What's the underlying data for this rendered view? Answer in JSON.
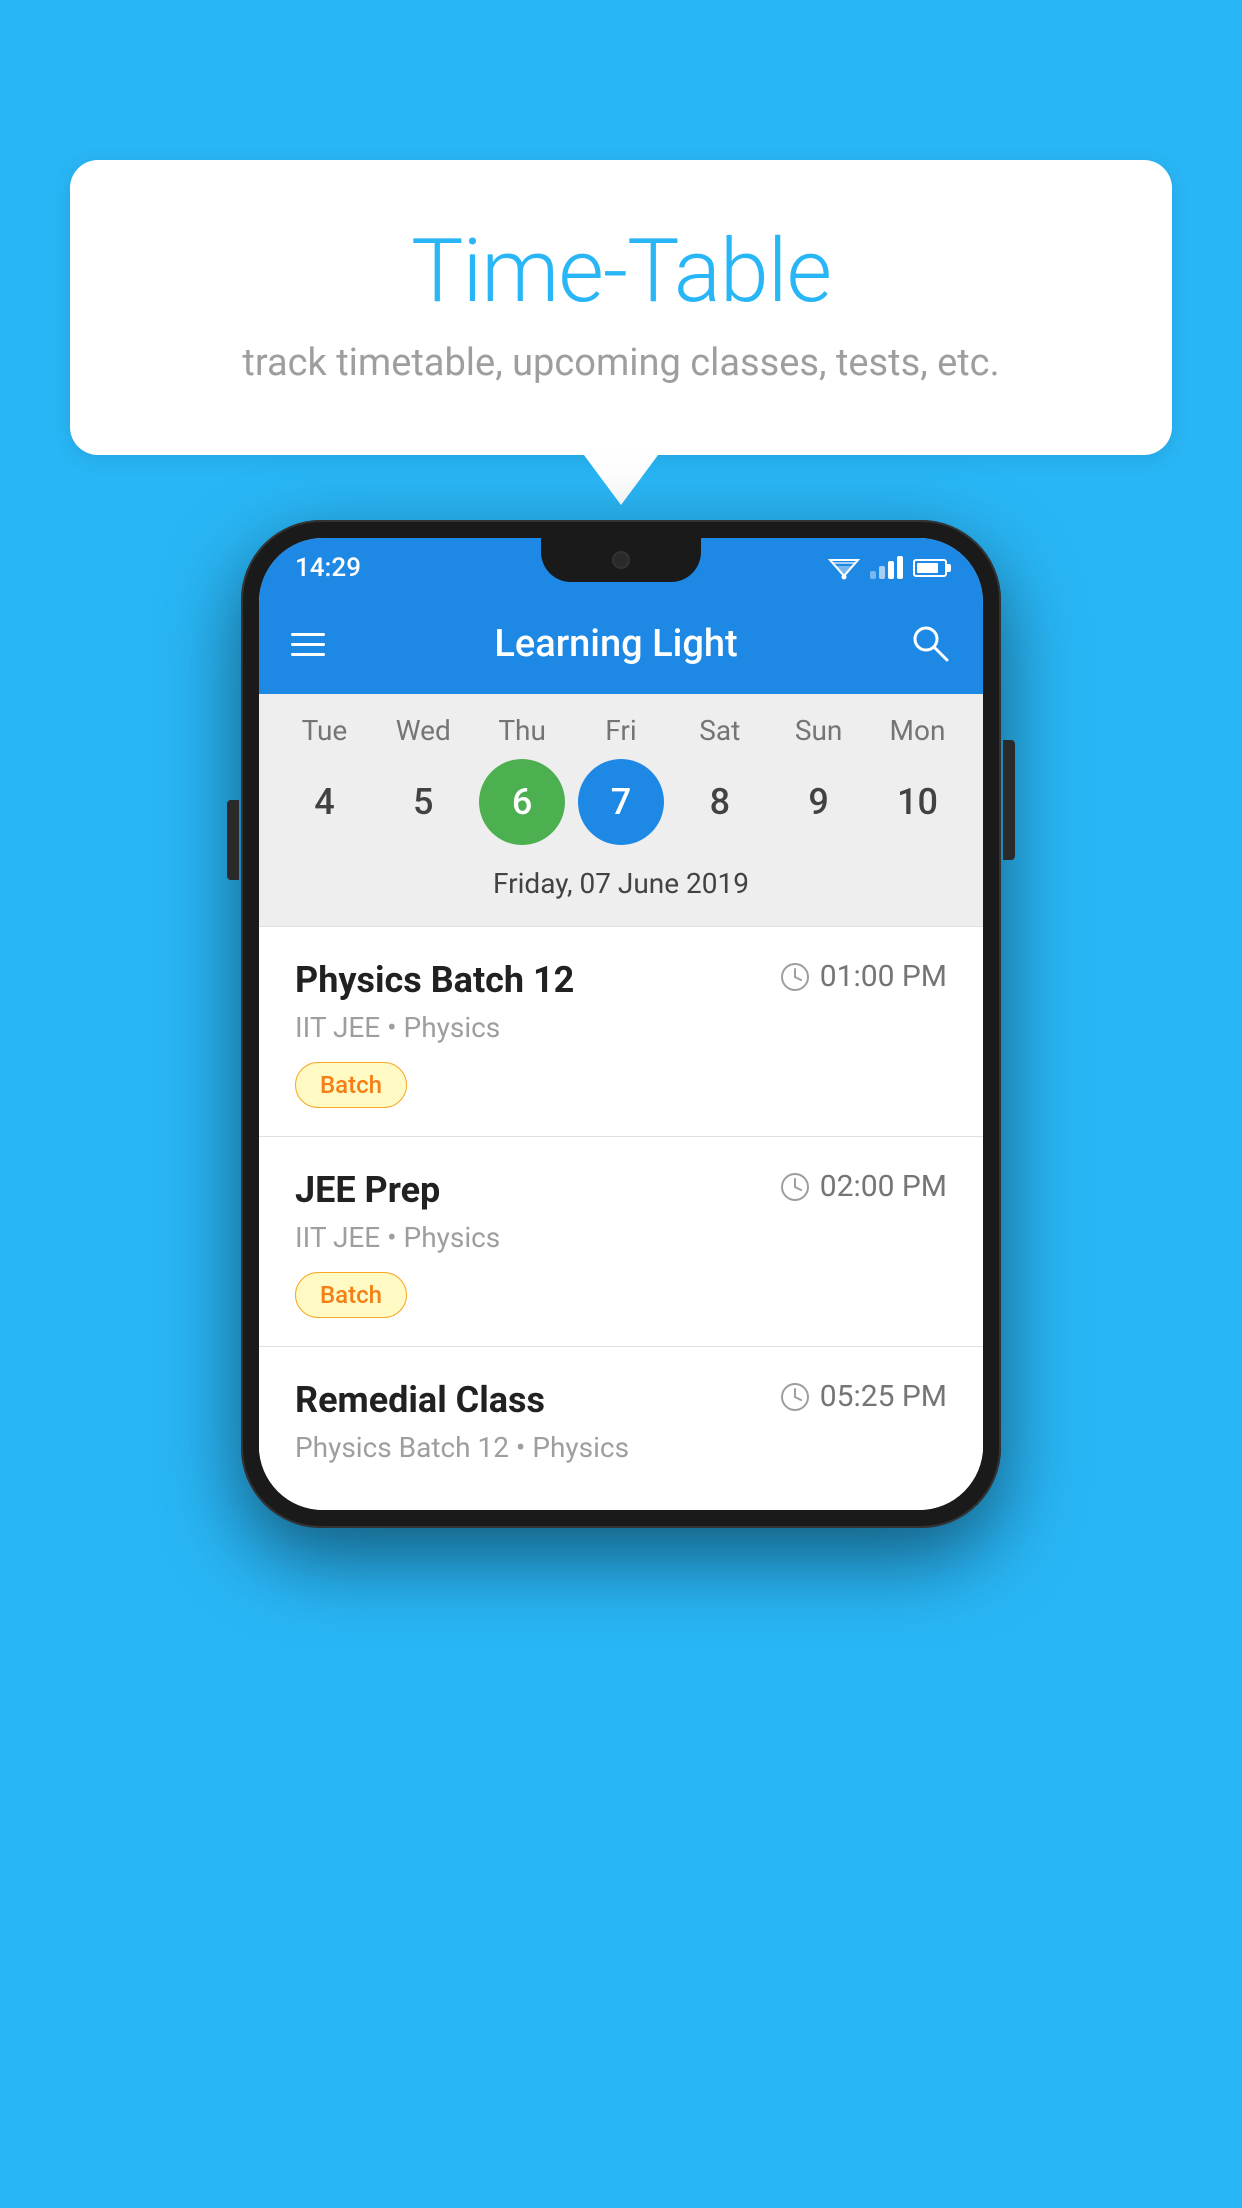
{
  "background_color": "#29B6F6",
  "bubble": {
    "title": "Time-Table",
    "subtitle": "track timetable, upcoming classes, tests, etc."
  },
  "phone": {
    "status_bar": {
      "time": "14:29"
    },
    "app_bar": {
      "title": "Learning Light"
    },
    "calendar": {
      "days": [
        "Tue",
        "Wed",
        "Thu",
        "Fri",
        "Sat",
        "Sun",
        "Mon"
      ],
      "dates": [
        4,
        5,
        6,
        7,
        8,
        9,
        10
      ],
      "today_index": 2,
      "selected_index": 3,
      "selected_label": "Friday, 07 June 2019"
    },
    "schedule": [
      {
        "class_name": "Physics Batch 12",
        "time": "01:00 PM",
        "meta": "IIT JEE • Physics",
        "badge": "Batch"
      },
      {
        "class_name": "JEE Prep",
        "time": "02:00 PM",
        "meta": "IIT JEE • Physics",
        "badge": "Batch"
      },
      {
        "class_name": "Remedial Class",
        "time": "05:25 PM",
        "meta": "Physics Batch 12 • Physics",
        "badge": null
      }
    ]
  }
}
